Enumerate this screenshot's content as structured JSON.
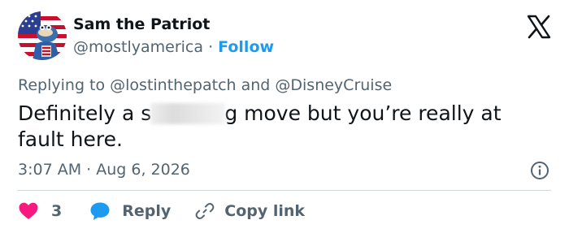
{
  "user": {
    "display_name": "Sam the Patriot",
    "handle": "@mostlyamerica",
    "separator": " · ",
    "follow_label": "Follow"
  },
  "reply": {
    "prefix": "Replying to ",
    "mention_1": "@lostinthepatch",
    "conjunction": " and ",
    "mention_2": "@DisneyCruise"
  },
  "tweet": {
    "text_before": "Definitely a s",
    "text_after": "g move but you’re really at fault here."
  },
  "meta": {
    "timestamp": "3:07 AM · Aug 6, 2026"
  },
  "actions": {
    "like_count": "3",
    "reply_label": "Reply",
    "copy_label": "Copy link"
  },
  "icons": {
    "brand": "x-logo-icon",
    "info": "info-icon",
    "like": "heart-icon",
    "reply": "speech-bubble-icon",
    "copy": "link-icon"
  },
  "colors": {
    "accent": "#1d9bf0",
    "like": "#f91880",
    "text_primary": "#0f1419",
    "text_secondary": "#536471"
  }
}
